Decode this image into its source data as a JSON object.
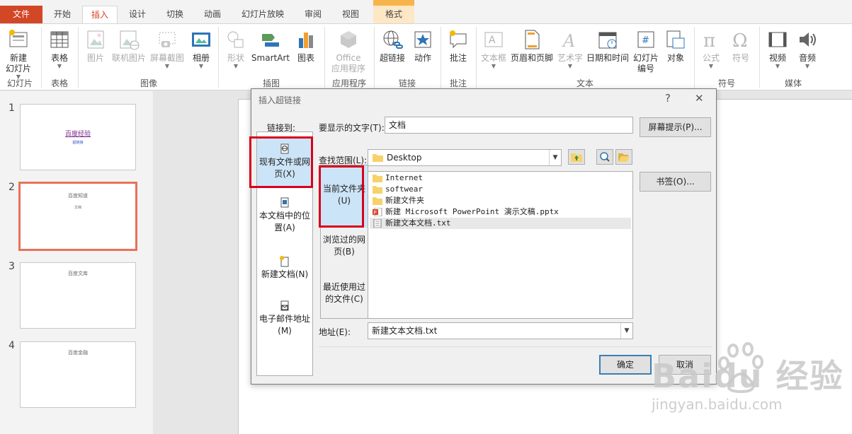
{
  "tabs": [
    "文件",
    "开始",
    "插入",
    "设计",
    "切换",
    "动画",
    "幻灯片放映",
    "审阅",
    "视图",
    "格式"
  ],
  "ribbon": {
    "buttons": {
      "new_slide": "新建\n幻灯片",
      "table": "表格",
      "picture": "图片",
      "online_picture": "联机图片",
      "screenshot": "屏幕截图",
      "album": "相册",
      "shapes": "形状",
      "smartart": "SmartArt",
      "chart": "图表",
      "office_apps_1": "Office",
      "office_apps_2": "应用程序",
      "hyperlink": "超链接",
      "action": "动作",
      "comment": "批注",
      "textbox": "文本框",
      "header_footer": "页眉和页脚",
      "wordart": "艺术字",
      "datetime": "日期和时间",
      "slide_number_1": "幻灯片",
      "slide_number_2": "编号",
      "object": "对象",
      "equation": "公式",
      "symbol": "符号",
      "video": "视频",
      "audio": "音频"
    },
    "groups": {
      "slides": "幻灯片",
      "tables": "表格",
      "images": "图像",
      "illustrations": "插图",
      "apps": "应用程序",
      "links": "链接",
      "comments": "批注",
      "text": "文本",
      "symbols": "符号",
      "media": "媒体"
    }
  },
  "slides": [
    {
      "num": "1",
      "title": "百度经验",
      "sub": "超链接"
    },
    {
      "num": "2",
      "title": "百度知道",
      "sub": "文档"
    },
    {
      "num": "3",
      "title": "百度文库",
      "sub": ""
    },
    {
      "num": "4",
      "title": "百度金融",
      "sub": ""
    }
  ],
  "dialog": {
    "title": "插入超链接",
    "help": "?",
    "close": "✕",
    "link_to": "链接到:",
    "link_options": [
      "现有文件或网页(X)",
      "本文档中的位置(A)",
      "新建文档(N)",
      "电子邮件地址(M)"
    ],
    "display_text_label": "要显示的文字(T):",
    "display_text_value": "文档",
    "screentip_button": "屏幕提示(P)...",
    "lookin_label": "查找范围(L):",
    "lookin_value": "Desktop",
    "sub_options": [
      "当前文件夹(U)",
      "浏览过的网页(B)",
      "最近使用过的文件(C)"
    ],
    "files": [
      {
        "name": "Internet",
        "type": "folder"
      },
      {
        "name": "softwear",
        "type": "folder"
      },
      {
        "name": "新建文件夹",
        "type": "folder"
      },
      {
        "name": "新建 Microsoft PowerPoint 演示文稿.pptx",
        "type": "pptx"
      },
      {
        "name": "新建文本文档.txt",
        "type": "txt"
      }
    ],
    "bookmark_button": "书签(O)...",
    "address_label": "地址(E):",
    "address_value": "新建文本文档.txt",
    "ok_button": "确定",
    "cancel_button": "取消"
  },
  "watermark": {
    "brand": "Baidu 经验",
    "url": "jingyan.baidu.com"
  }
}
